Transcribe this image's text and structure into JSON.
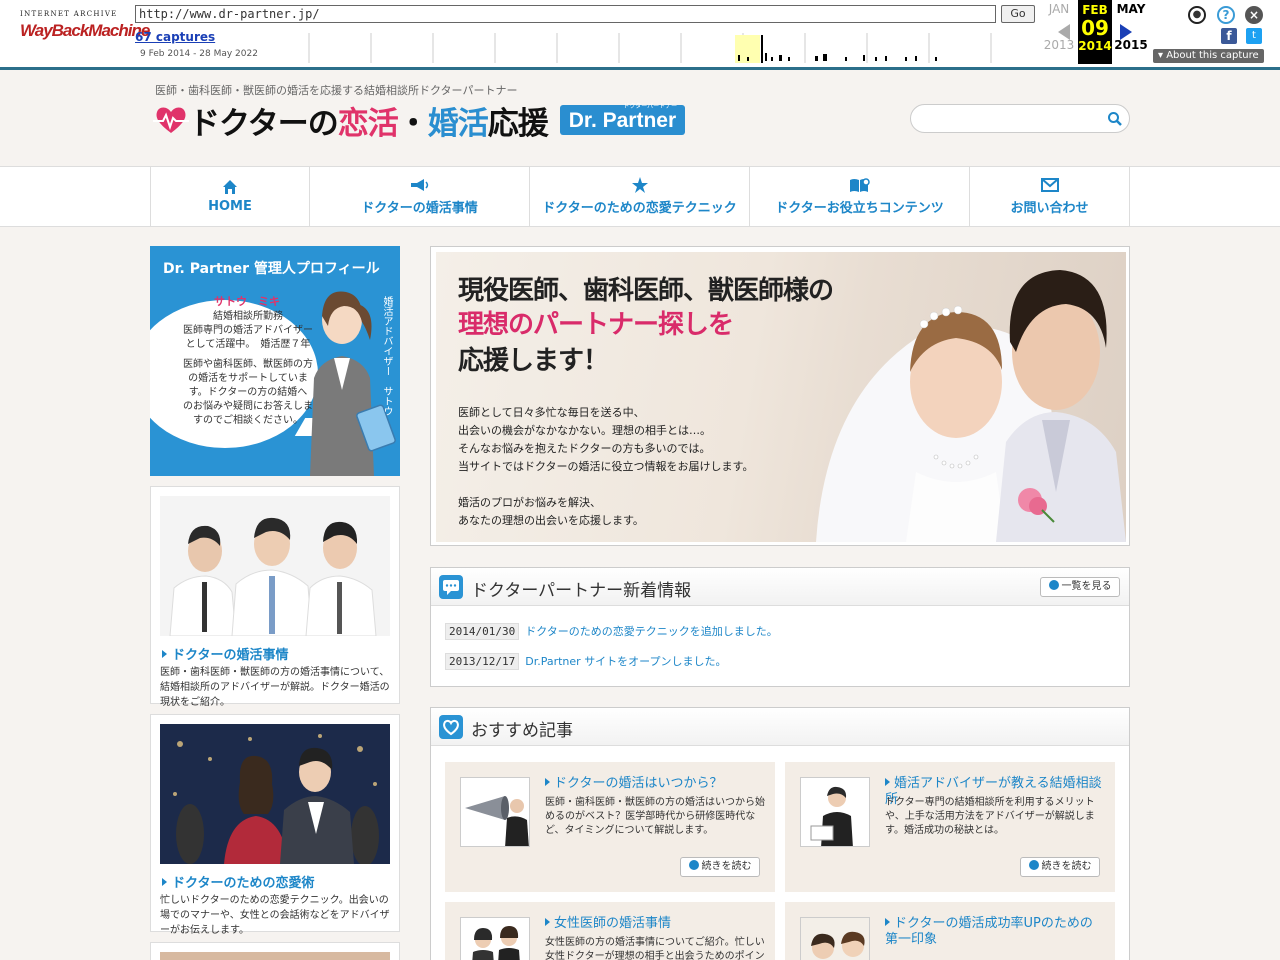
{
  "wayback": {
    "logo_top": "INTERNET ARCHIVE",
    "logo_main": "WayBackMachine",
    "url": "http://www.dr-partner.jp/",
    "go_label": "Go",
    "captures": "67 captures",
    "date_range": "9 Feb 2014 - 28 May 2022",
    "prev_month": "JAN",
    "cur_month": "FEB",
    "next_month": "MAY",
    "cur_day": "09",
    "prev_year": "2013",
    "cur_year": "2014",
    "next_year": "2015",
    "about": "About this capture"
  },
  "site": {
    "tagline": "医師・歯科医師・獣医師の婚活を応援する結婚相談所ドクターパートナー",
    "logo_a": "ドクターの",
    "logo_b": "恋活",
    "logo_c": "・",
    "logo_d": "婚活",
    "logo_e": "応援",
    "badge": "Dr. Partner",
    "badge_small": "ドクターパートナー",
    "search_placeholder": ""
  },
  "nav": [
    {
      "label": "HOME",
      "icon": "home-icon"
    },
    {
      "label": "ドクターの婚活事情",
      "icon": "megaphone-icon"
    },
    {
      "label": "ドクターのための恋愛テクニック",
      "icon": "star-icon"
    },
    {
      "label": "ドクターお役立ちコンテンツ",
      "icon": "book-icon"
    },
    {
      "label": "お問い合わせ",
      "icon": "mail-icon"
    }
  ],
  "profile": {
    "title": "Dr. Partner 管理人プロフィール",
    "name": "サトウ　ミキ",
    "text1": "結婚相談所勤務",
    "text2": "医師専門の婚活アドバイザー",
    "text3": "として活躍中。　婚活歴７年",
    "text4": "医師や歯科医師、獣医師の方",
    "text5": "の婚活をサポートしていま",
    "text6": "す。ドクターの方の結婚へ",
    "text7": "のお悩みや疑問にお答えしま",
    "text8": "すのでご相談ください。",
    "vertical": "婚活アドバイザー　サトウ"
  },
  "side_cards": [
    {
      "title": "ドクターの婚活事情",
      "desc": "医師・歯科医師・獣医師の方の婚活事情について、結婚相談所のアドバイザーが解説。ドクター婚活の現状をご紹介。"
    },
    {
      "title": "ドクターのための恋愛術",
      "desc": "忙しいドクターのための恋愛テクニック。出会いの場でのマナーや、女性との会話術などをアドバイザーがお伝えします。"
    }
  ],
  "hero": {
    "line1": "現役医師、歯科医師、獣医師様の",
    "line2": "理想のパートナー探しを",
    "line3": "応援します！",
    "para": "医師として日々多忙な毎日を送る中、\n出会いの機会がなかなかない。理想の相手とは…。\nそんなお悩みを抱えたドクターの方も多いのでは。\n当サイトではドクターの婚活に役立つ情報をお届けします。\n\n婚活のプロがお悩みを解決、\nあなたの理想の出会いを応援します。"
  },
  "news": {
    "title": "ドクターパートナー新着情報",
    "more": "一覧を見る",
    "items": [
      {
        "date": "2014/01/30",
        "text": "ドクターのための恋愛テクニックを追加しました。"
      },
      {
        "date": "2013/12/17",
        "text": "Dr.Partner サイトをオープンしました。"
      }
    ]
  },
  "articles": {
    "title": "おすすめ記事",
    "read_more": "続きを読む",
    "items": [
      {
        "title": "ドクターの婚活はいつから？",
        "desc": "医師・歯科医師・獣医師の方の婚活はいつから始めるのがベスト？医学部時代から研修医時代など、タイミングについて解説します。"
      },
      {
        "title": "婚活アドバイザーが教える結婚相談所",
        "desc": "ドクター専門の結婚相談所を利用するメリットや、上手な活用方法をアドバイザーが解説します。婚活成功の秘訣とは。"
      },
      {
        "title": "女性医師の婚活事情",
        "desc": "女性医師の方の婚活事情についてご紹介。忙しい女性ドクターが理想の相手と出会うためのポイントとは。"
      },
      {
        "title": "ドクターの婚活成功率UPのための第一印象",
        "desc": ""
      }
    ]
  },
  "colors": {
    "accent_blue": "#1d86c8",
    "accent_pink": "#e0336a",
    "wayback_red": "#b22222"
  }
}
